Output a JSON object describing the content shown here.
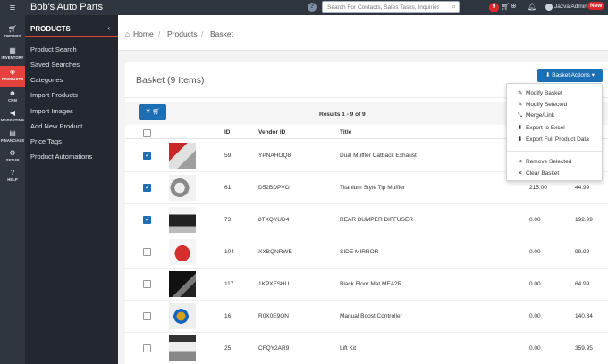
{
  "header": {
    "brand": "Bob's Auto Parts",
    "search_placeholder": "Search For Contacts, Sales Tasks, Inquiries, Etc.",
    "basket_count": "9",
    "user_name": "Jazva Admin",
    "new_badge": "New"
  },
  "rail": [
    {
      "label": "ORDERS",
      "icon": "cart-icon"
    },
    {
      "label": "INVENTORY",
      "icon": "cubes-icon"
    },
    {
      "label": "PRODUCTS",
      "icon": "tag-icon"
    },
    {
      "label": "CRM",
      "icon": "users-icon"
    },
    {
      "label": "MARKETING",
      "icon": "megaphone-icon"
    },
    {
      "label": "FINANCIALS",
      "icon": "chart-icon"
    },
    {
      "label": "SETUP",
      "icon": "gear-icon"
    },
    {
      "label": "HELP",
      "icon": "question-icon"
    }
  ],
  "subnav": {
    "title": "PRODUCTS",
    "items": [
      "Product Search",
      "Saved Searches",
      "Categories",
      "Import Products",
      "Import Images",
      "Add New Product",
      "Price Tags",
      "Product Automations"
    ]
  },
  "breadcrumb": [
    "Home",
    "Products",
    "Basket"
  ],
  "panel": {
    "title": "Basket (9 Items)",
    "actions_label": "Basket Actions",
    "results_text": "Results 1 - 9 of 9"
  },
  "table": {
    "headers": {
      "id": "ID",
      "vendor_id": "Vendor ID",
      "title": "Title"
    },
    "rows": [
      {
        "checked": true,
        "id": "59",
        "vendor_id": "YPNAHOQ8",
        "title": "Dual Muffler Catback Exhaust",
        "col5": "",
        "col6": ""
      },
      {
        "checked": true,
        "id": "61",
        "vendor_id": "D52BDPVO",
        "title": "Titanium Style Tip Muffler",
        "col5": "215.00",
        "col6": "44.99"
      },
      {
        "checked": true,
        "id": "73",
        "vendor_id": "8TXQYUD4",
        "title": "REAR BUMPER DIFFUSER",
        "col5": "0.00",
        "col6": "192.99"
      },
      {
        "checked": false,
        "id": "104",
        "vendor_id": "XXBQNRWE",
        "title": "SIDE MIRROR",
        "col5": "0.00",
        "col6": "99.99"
      },
      {
        "checked": false,
        "id": "117",
        "vendor_id": "1KPXFSHU",
        "title": "Black Floor Mat MEA2R",
        "col5": "0.00",
        "col6": "64.99"
      },
      {
        "checked": false,
        "id": "16",
        "vendor_id": "R0X0E9QN",
        "title": "Manual Boost Controller",
        "col5": "0.00",
        "col6": "140.34"
      },
      {
        "checked": false,
        "id": "25",
        "vendor_id": "CFQY2AR9",
        "title": "Lift Kit",
        "col5": "0.00",
        "col6": "359.95"
      }
    ]
  },
  "dropdown": {
    "items": [
      "Modify Basket",
      "Modify Selected",
      "Merge/Link",
      "Export to Excel",
      "Export Full Product Data"
    ],
    "items2": [
      "Remove Selected",
      "Clear Basket"
    ]
  },
  "colors": {
    "accent": "#1c6fb5",
    "active_nav": "#e5413d",
    "sidebar": "#2f3640"
  }
}
